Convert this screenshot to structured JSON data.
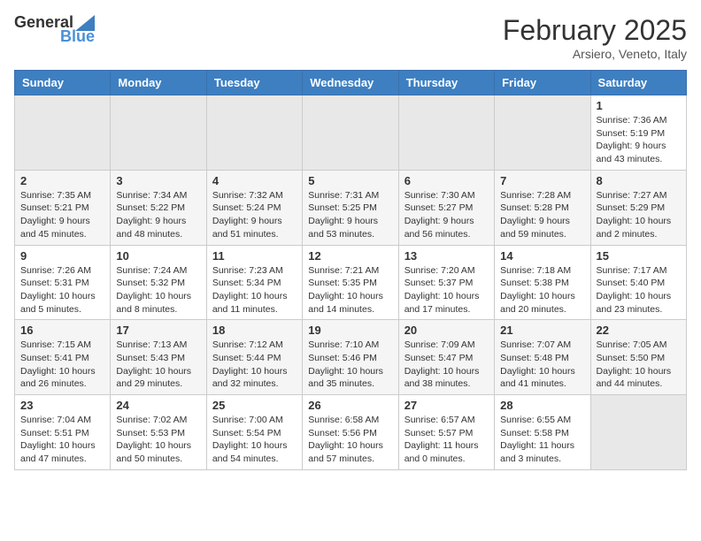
{
  "logo": {
    "general": "General",
    "blue": "Blue"
  },
  "title": "February 2025",
  "subtitle": "Arsiero, Veneto, Italy",
  "days_of_week": [
    "Sunday",
    "Monday",
    "Tuesday",
    "Wednesday",
    "Thursday",
    "Friday",
    "Saturday"
  ],
  "weeks": [
    [
      {
        "day": "",
        "info": ""
      },
      {
        "day": "",
        "info": ""
      },
      {
        "day": "",
        "info": ""
      },
      {
        "day": "",
        "info": ""
      },
      {
        "day": "",
        "info": ""
      },
      {
        "day": "",
        "info": ""
      },
      {
        "day": "1",
        "info": "Sunrise: 7:36 AM\nSunset: 5:19 PM\nDaylight: 9 hours and 43 minutes."
      }
    ],
    [
      {
        "day": "2",
        "info": "Sunrise: 7:35 AM\nSunset: 5:21 PM\nDaylight: 9 hours and 45 minutes."
      },
      {
        "day": "3",
        "info": "Sunrise: 7:34 AM\nSunset: 5:22 PM\nDaylight: 9 hours and 48 minutes."
      },
      {
        "day": "4",
        "info": "Sunrise: 7:32 AM\nSunset: 5:24 PM\nDaylight: 9 hours and 51 minutes."
      },
      {
        "day": "5",
        "info": "Sunrise: 7:31 AM\nSunset: 5:25 PM\nDaylight: 9 hours and 53 minutes."
      },
      {
        "day": "6",
        "info": "Sunrise: 7:30 AM\nSunset: 5:27 PM\nDaylight: 9 hours and 56 minutes."
      },
      {
        "day": "7",
        "info": "Sunrise: 7:28 AM\nSunset: 5:28 PM\nDaylight: 9 hours and 59 minutes."
      },
      {
        "day": "8",
        "info": "Sunrise: 7:27 AM\nSunset: 5:29 PM\nDaylight: 10 hours and 2 minutes."
      }
    ],
    [
      {
        "day": "9",
        "info": "Sunrise: 7:26 AM\nSunset: 5:31 PM\nDaylight: 10 hours and 5 minutes."
      },
      {
        "day": "10",
        "info": "Sunrise: 7:24 AM\nSunset: 5:32 PM\nDaylight: 10 hours and 8 minutes."
      },
      {
        "day": "11",
        "info": "Sunrise: 7:23 AM\nSunset: 5:34 PM\nDaylight: 10 hours and 11 minutes."
      },
      {
        "day": "12",
        "info": "Sunrise: 7:21 AM\nSunset: 5:35 PM\nDaylight: 10 hours and 14 minutes."
      },
      {
        "day": "13",
        "info": "Sunrise: 7:20 AM\nSunset: 5:37 PM\nDaylight: 10 hours and 17 minutes."
      },
      {
        "day": "14",
        "info": "Sunrise: 7:18 AM\nSunset: 5:38 PM\nDaylight: 10 hours and 20 minutes."
      },
      {
        "day": "15",
        "info": "Sunrise: 7:17 AM\nSunset: 5:40 PM\nDaylight: 10 hours and 23 minutes."
      }
    ],
    [
      {
        "day": "16",
        "info": "Sunrise: 7:15 AM\nSunset: 5:41 PM\nDaylight: 10 hours and 26 minutes."
      },
      {
        "day": "17",
        "info": "Sunrise: 7:13 AM\nSunset: 5:43 PM\nDaylight: 10 hours and 29 minutes."
      },
      {
        "day": "18",
        "info": "Sunrise: 7:12 AM\nSunset: 5:44 PM\nDaylight: 10 hours and 32 minutes."
      },
      {
        "day": "19",
        "info": "Sunrise: 7:10 AM\nSunset: 5:46 PM\nDaylight: 10 hours and 35 minutes."
      },
      {
        "day": "20",
        "info": "Sunrise: 7:09 AM\nSunset: 5:47 PM\nDaylight: 10 hours and 38 minutes."
      },
      {
        "day": "21",
        "info": "Sunrise: 7:07 AM\nSunset: 5:48 PM\nDaylight: 10 hours and 41 minutes."
      },
      {
        "day": "22",
        "info": "Sunrise: 7:05 AM\nSunset: 5:50 PM\nDaylight: 10 hours and 44 minutes."
      }
    ],
    [
      {
        "day": "23",
        "info": "Sunrise: 7:04 AM\nSunset: 5:51 PM\nDaylight: 10 hours and 47 minutes."
      },
      {
        "day": "24",
        "info": "Sunrise: 7:02 AM\nSunset: 5:53 PM\nDaylight: 10 hours and 50 minutes."
      },
      {
        "day": "25",
        "info": "Sunrise: 7:00 AM\nSunset: 5:54 PM\nDaylight: 10 hours and 54 minutes."
      },
      {
        "day": "26",
        "info": "Sunrise: 6:58 AM\nSunset: 5:56 PM\nDaylight: 10 hours and 57 minutes."
      },
      {
        "day": "27",
        "info": "Sunrise: 6:57 AM\nSunset: 5:57 PM\nDaylight: 11 hours and 0 minutes."
      },
      {
        "day": "28",
        "info": "Sunrise: 6:55 AM\nSunset: 5:58 PM\nDaylight: 11 hours and 3 minutes."
      },
      {
        "day": "",
        "info": ""
      }
    ]
  ]
}
